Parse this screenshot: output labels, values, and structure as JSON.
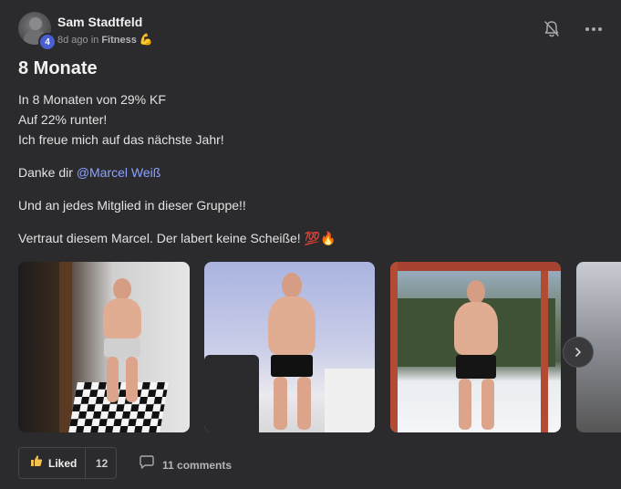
{
  "post": {
    "author": {
      "name": "Sam Stadtfeld",
      "level": "4"
    },
    "meta": {
      "time": "8d ago in",
      "category": "Fitness",
      "category_emoji": "💪"
    },
    "title": "8 Monate",
    "body": {
      "line1": "In 8 Monaten von 29% KF",
      "line2": "Auf 22% runter!",
      "line3": "Ich freue mich auf das nächste Jahr!",
      "thanks_prefix": "Danke dir ",
      "mention": "@Marcel Weiß",
      "group_line": "Und an jedes Mitglied in dieser Gruppe!!",
      "trust_line": "Vertraut diesem Marcel. Der labert keine Scheiße! 💯🔥"
    },
    "icons": {
      "bell": "bell-icon",
      "more": "more-horizontal-icon",
      "next": "chevron-right-icon",
      "like": "thumbs-up-icon",
      "comment": "comment-icon"
    },
    "actions": {
      "like_label": "Liked",
      "like_count": "12",
      "comments_label": "11 comments"
    }
  }
}
